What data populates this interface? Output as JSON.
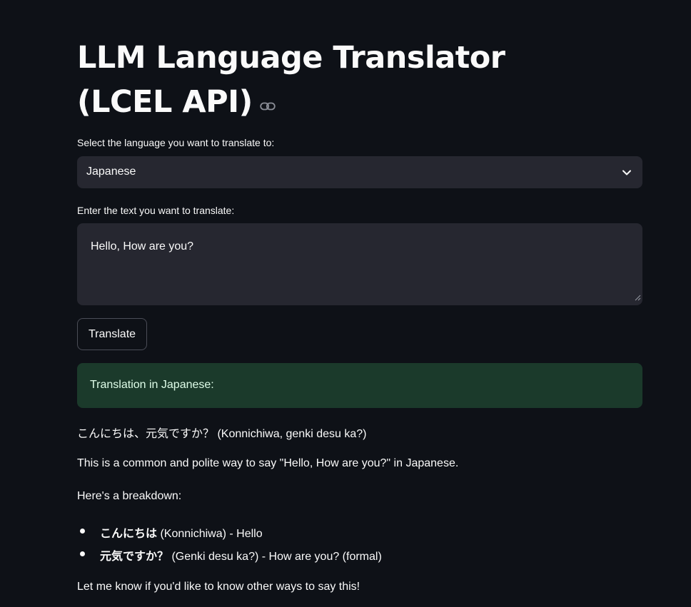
{
  "title": "LLM Language Translator (LCEL API)",
  "language_select": {
    "label": "Select the language you want to translate to:",
    "value": "Japanese"
  },
  "text_input": {
    "label": "Enter the text you want to translate:",
    "value": "Hello, How are you?"
  },
  "translate_button": {
    "label": "Translate"
  },
  "result": {
    "heading": "Translation in Japanese:",
    "line1": "こんにちは、元気ですか？ (Konnichiwa, genki desu ka?)",
    "line2": "This is a common and polite way to say \"Hello, How are you?\" in Japanese.",
    "line3": "Here's a breakdown:",
    "bullets": [
      {
        "term": "こんにちは",
        "rest": " (Konnichiwa) - Hello"
      },
      {
        "term": "元気ですか？",
        "rest": " (Genki desu ka?) - How are you? (formal)"
      }
    ],
    "line4": "Let me know if you'd like to know other ways to say this!"
  },
  "colors": {
    "background": "#0e1117",
    "input_bg": "#262730",
    "success_bg": "#1b3a2b"
  }
}
